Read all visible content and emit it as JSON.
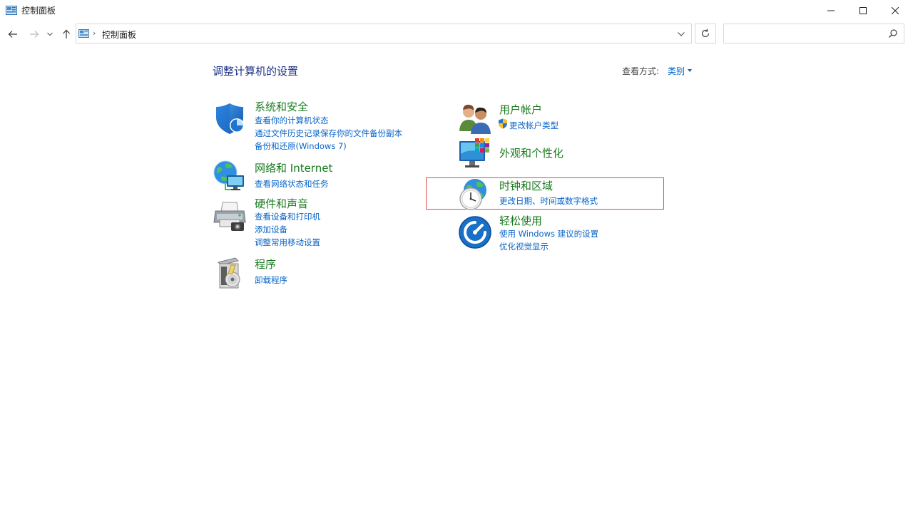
{
  "window": {
    "title": "控制面板",
    "controls": [
      "minimize-icon",
      "maximize-icon",
      "close-icon"
    ]
  },
  "address_bar": {
    "path": "控制面板",
    "search_placeholder": ""
  },
  "header": {
    "title": "调整计算机的设置",
    "view_by_label": "查看方式:",
    "view_by_value": "类别"
  },
  "categories": {
    "system_security": {
      "title": "系统和安全",
      "icon": "shield-icon",
      "links": [
        "查看你的计算机状态",
        "通过文件历史记录保存你的文件备份副本",
        "备份和还原(Windows 7)"
      ]
    },
    "network_internet": {
      "title": "网络和 Internet",
      "icon": "network-globe-icon",
      "links": [
        "查看网络状态和任务"
      ]
    },
    "hardware_sound": {
      "title": "硬件和声音",
      "icon": "printer-icon",
      "links": [
        "查看设备和打印机",
        "添加设备",
        "调整常用移动设置"
      ]
    },
    "programs": {
      "title": "程序",
      "icon": "programs-disc-icon",
      "links": [
        "卸载程序"
      ]
    },
    "user_accounts": {
      "title": "用户帐户",
      "icon": "users-icon",
      "links": [
        "更改帐户类型"
      ]
    },
    "appearance": {
      "title": "外观和个性化",
      "icon": "monitor-palette-icon",
      "links": []
    },
    "clock_region": {
      "title": "时钟和区域",
      "icon": "clock-globe-icon",
      "links": [
        "更改日期、时间或数字格式"
      ]
    },
    "ease_of_access": {
      "title": "轻松使用",
      "icon": "ease-of-access-icon",
      "links": [
        "使用 Windows 建议的设置",
        "优化视觉显示"
      ]
    }
  },
  "colors": {
    "category_title": "#197a1e",
    "link": "#0a64c8",
    "page_title": "#1e3287",
    "highlight_border": "#e04848"
  }
}
